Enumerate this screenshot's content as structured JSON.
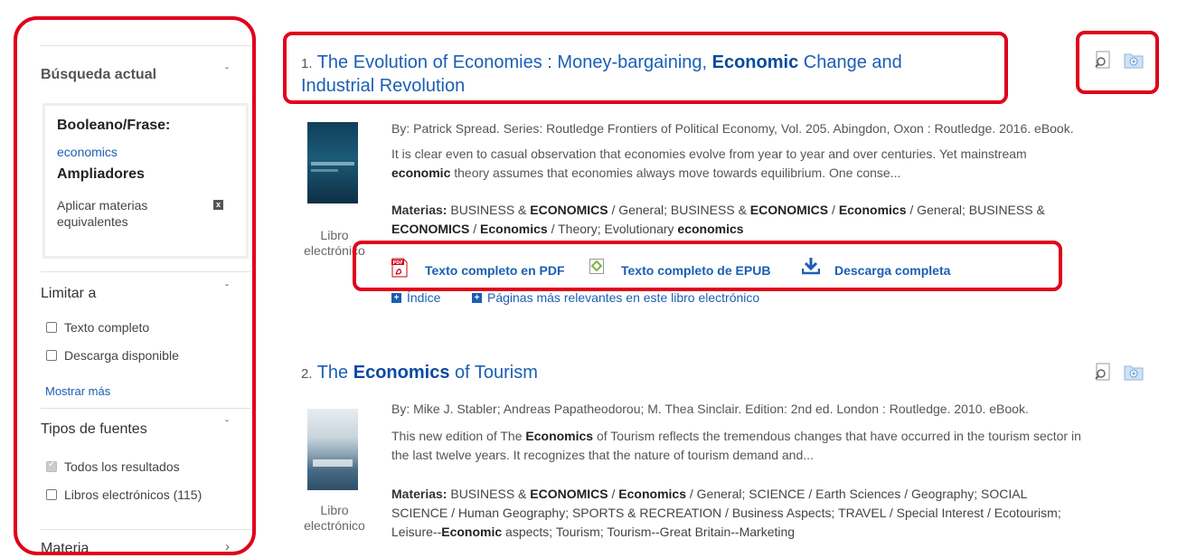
{
  "sidebar": {
    "current_search": {
      "title": "Búsqueda actual",
      "boolean_label": "Booleano/Frase:",
      "boolean_value": "economics",
      "expanders_label": "Ampliadores",
      "expander_item": "Aplicar materias equivalentes",
      "remove_symbol": "x"
    },
    "limit": {
      "title": "Limitar a",
      "options": [
        "Texto completo",
        "Descarga disponible"
      ],
      "more": "Mostrar más"
    },
    "source_types": {
      "title": "Tipos de fuentes",
      "options": [
        "Todos los resultados",
        "Libros electrónicos (115)"
      ]
    },
    "subject": {
      "title": "Materia"
    },
    "chevron_down": "ˇ",
    "chevron_right": "›"
  },
  "results": [
    {
      "num": "1.",
      "title_pre": "The Evolution of Economies : Money-bargaining, ",
      "title_hl": "Economic",
      "title_post": " Change and",
      "title_line2": "Industrial Revolution",
      "meta": "By: Patrick Spread. Series: Routledge Frontiers of Political Economy, Vol. 205. Abingdon, Oxon : Routledge. 2016. eBook.",
      "abstract_1": "It is clear even to casual observation that economies evolve from year to year and over centuries. Yet mainstream",
      "abstract_hl": "economic",
      "abstract_2": " theory assumes that economies always move towards equilibrium. One conse...",
      "subjects_label": "Materias:",
      "s1": " BUSINESS & ",
      "s1b": "ECONOMICS",
      "s2": " / General; BUSINESS & ",
      "s2b": "ECONOMICS",
      "s3": " / ",
      "s3b": "Economics",
      "s4": " / General; BUSINESS &",
      "s5b": "ECONOMICS",
      "s6": " / ",
      "s6b": "Economics",
      "s7": " / Theory; Evolutionary ",
      "s7b": "economics",
      "format_1": "Libro",
      "format_2": "electrónico",
      "links": {
        "pdf": "Texto completo en PDF",
        "epub": "Texto completo de EPUB",
        "download": "Descarga completa",
        "pdf_icon_text": "PDF"
      },
      "expanders": {
        "index": "Índice",
        "pages": "Páginas más relevantes en este libro electrónico"
      }
    },
    {
      "num": "2.",
      "title_pre": "The ",
      "title_hl": "Economics",
      "title_post": " of Tourism",
      "meta": "By: Mike J. Stabler; Andreas Papatheodorou; M. Thea Sinclair. Edition: 2nd ed. London : Routledge. 2010. eBook.",
      "abstract_1": "This new edition of The ",
      "abstract_hl": "Economics",
      "abstract_2": " of Tourism reflects the tremendous changes that have occurred in the tourism sector in",
      "abstract_3": "the last twelve years. It recognizes that the nature of tourism demand and...",
      "subjects_label": "Materias:",
      "s1": " BUSINESS & ",
      "s1b": "ECONOMICS",
      "s2": " / ",
      "s2b": "Economics",
      "s3": " / General; SCIENCE / Earth Sciences / Geography; SOCIAL",
      "s4": "SCIENCE / Human Geography; SPORTS & RECREATION / Business Aspects; TRAVEL / Special Interest / Ecotourism;",
      "s5": "Leisure--",
      "s5b": "Economic",
      "s6": " aspects; Tourism; Tourism--Great Britain--Marketing",
      "format_1": "Libro",
      "format_2": "electrónico"
    }
  ],
  "colors": {
    "highlight": "#e0001b",
    "link": "#1a5fb4"
  }
}
